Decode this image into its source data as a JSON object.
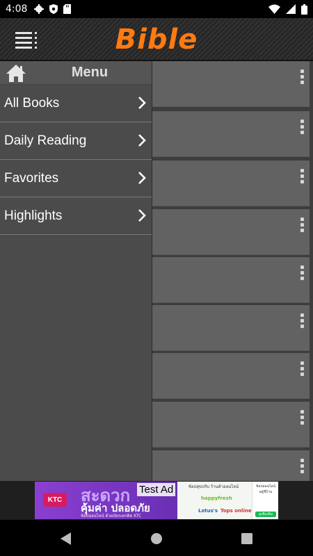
{
  "status_bar": {
    "time": "4:08",
    "left_icons": [
      "gear-icon",
      "shield-icon",
      "sd-card-icon"
    ],
    "right_icons": [
      "wifi-icon",
      "signal-icon",
      "battery-icon"
    ]
  },
  "app_bar": {
    "title": "Bible",
    "title_color": "#ff7b12",
    "menu_icon": "hamburger-menu-icon"
  },
  "drawer": {
    "title": "Menu",
    "home_icon": "home-icon",
    "items": [
      {
        "label": "All Books",
        "icon": "chevron-right-icon"
      },
      {
        "label": "Daily Reading",
        "icon": "chevron-right-icon"
      },
      {
        "label": "Favorites",
        "icon": "chevron-right-icon"
      },
      {
        "label": "Highlights",
        "icon": "chevron-right-icon"
      }
    ]
  },
  "cards": {
    "count": 9,
    "menu_icon": "more-vert-icon"
  },
  "ad": {
    "label": "Test Ad",
    "brand": "KTC",
    "headline_th": "สะดวก",
    "subline_th": "คุ้มค่า ปลอดภัย",
    "fineprint_th": "ช้อปออนไลน์ ด้วยบัตรเครดิต KTC",
    "right_header_th": "ช้อปสุขปรับ ร้านค้าออนไลน์",
    "logos": [
      "happyfresh",
      "Lotus's",
      "Tops online"
    ],
    "side_text_th": "ช้อปออนไลน์ อยู่ที่บ้าน",
    "side_button_th": "ดูเพิ่มเติม"
  },
  "nav_bar": {
    "icons": [
      "back-icon",
      "home-circle-icon",
      "recents-icon"
    ]
  }
}
